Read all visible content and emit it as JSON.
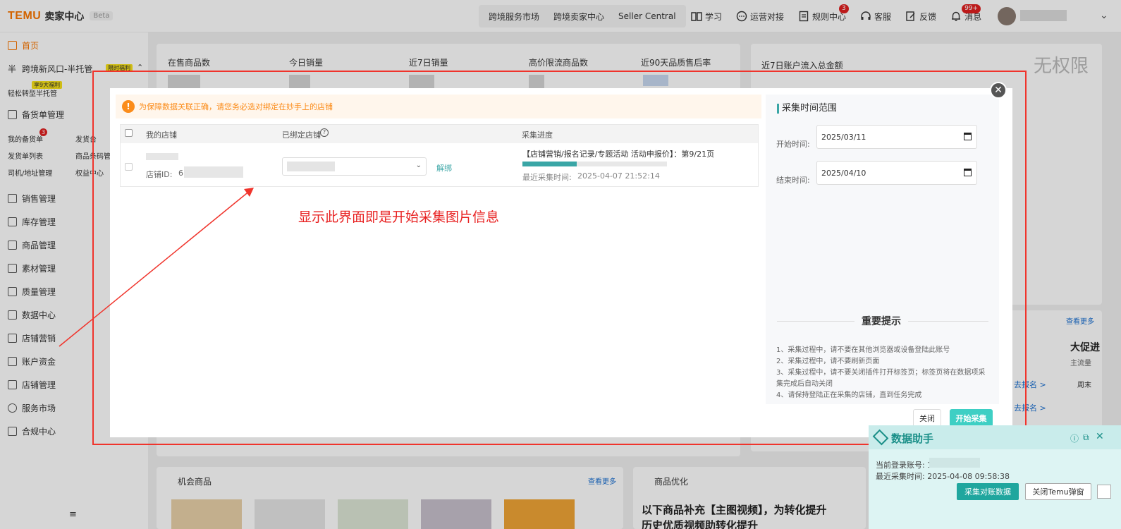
{
  "header": {
    "logo": "TEMU",
    "logo_sub": "卖家中心",
    "beta": "Beta",
    "market_tabs": [
      "跨境服务市场",
      "跨境卖家中心",
      "Seller Central"
    ],
    "nav": [
      {
        "label": "学习",
        "icon": "book-icon",
        "badge": ""
      },
      {
        "label": "运营对接",
        "icon": "chat-icon",
        "badge": ""
      },
      {
        "label": "规则中心",
        "icon": "document-icon",
        "badge": "3"
      },
      {
        "label": "客服",
        "icon": "headset-icon",
        "badge": ""
      },
      {
        "label": "反馈",
        "icon": "edit-icon",
        "badge": ""
      },
      {
        "label": "消息",
        "icon": "bell-icon",
        "badge": "99+"
      }
    ]
  },
  "sidebar": {
    "home": "首页",
    "promo": "跨境新风口-半托管",
    "promo_prefix": "半",
    "promo_tag": "限时福利",
    "promo_sub": "轻松转型半托管",
    "promo_sub_tag": "享9大福利",
    "stock_order": "备货单管理",
    "stock_sub": [
      "我的备货单",
      "发货台",
      "发货单列表",
      "商品条码管",
      "司机/地址管理",
      "权益中心"
    ],
    "stock_badge": "3",
    "items": [
      "销售管理",
      "库存管理",
      "商品管理",
      "素材管理",
      "质量管理",
      "数据中心",
      "店铺营销",
      "账户资金",
      "店铺管理",
      "服务市场",
      "合规中心"
    ]
  },
  "dashboard": {
    "stats": [
      "在售商品数",
      "今日销量",
      "近7日销量",
      "高价限流商品数",
      "近90天品质售后率"
    ],
    "flow_title": "近7日账户流入总金额",
    "no_permission": "无权限",
    "view_more": "查看更多",
    "big_promo": "大促进",
    "main_flow": "主流量",
    "go_register": "去报名 >",
    "weekend": "周末",
    "opportunity": "机会商品",
    "optimization": "商品优化",
    "opt_banner": "以下商品补充【主图视频】，为转化提升",
    "opt_banner2": "历史优质视频助转化提升"
  },
  "modal": {
    "notice": "为保障数据关联正确，请您务必选对绑定在妙手上的店铺",
    "columns": {
      "my_store": "我的店铺",
      "bound_store": "已绑定店铺",
      "progress": "采集进度"
    },
    "row": {
      "store_id_label": "店铺ID:",
      "store_id_prefix": "6",
      "unbind": "解绑",
      "progress_text": "【店铺营销/报名记录/专题活动 活动申报价】：第9/21页",
      "progress_ratio": 0.375,
      "last_collect_label": "最近采集时间:",
      "last_collect_time": "2025-04-07 21:52:14"
    },
    "annotation": "显示此界面即是开始采集图片信息",
    "time_range_title": "采集时间范围",
    "start_label": "开始时间:",
    "start_value": "2025/03/11",
    "end_label": "结束时间:",
    "end_value": "2025/04/10",
    "important_title": "重要提示",
    "tips": [
      "1、采集过程中，请不要在其他浏览器或设备登陆此账号",
      "2、采集过程中，请不要刷新页面",
      "3、采集过程中，请不要关闭插件打开标签页；标签页将在数据项采集完成后自动关闭",
      "4、请保持登陆正在采集的店铺，直到任务完成"
    ],
    "close_btn": "关闭",
    "start_btn": "开始采集"
  },
  "assistant": {
    "title": "数据助手",
    "login_label": "当前登录账号: 1",
    "last_collect": "最近采集时间: 2025-04-08 09:58:38",
    "collect_btn": "采集对账数据",
    "close_btn": "关闭Temu弹窗"
  },
  "colors": {
    "brand": "#fb7701",
    "teal": "#3aa6a6",
    "annotation_red": "#e82222"
  }
}
